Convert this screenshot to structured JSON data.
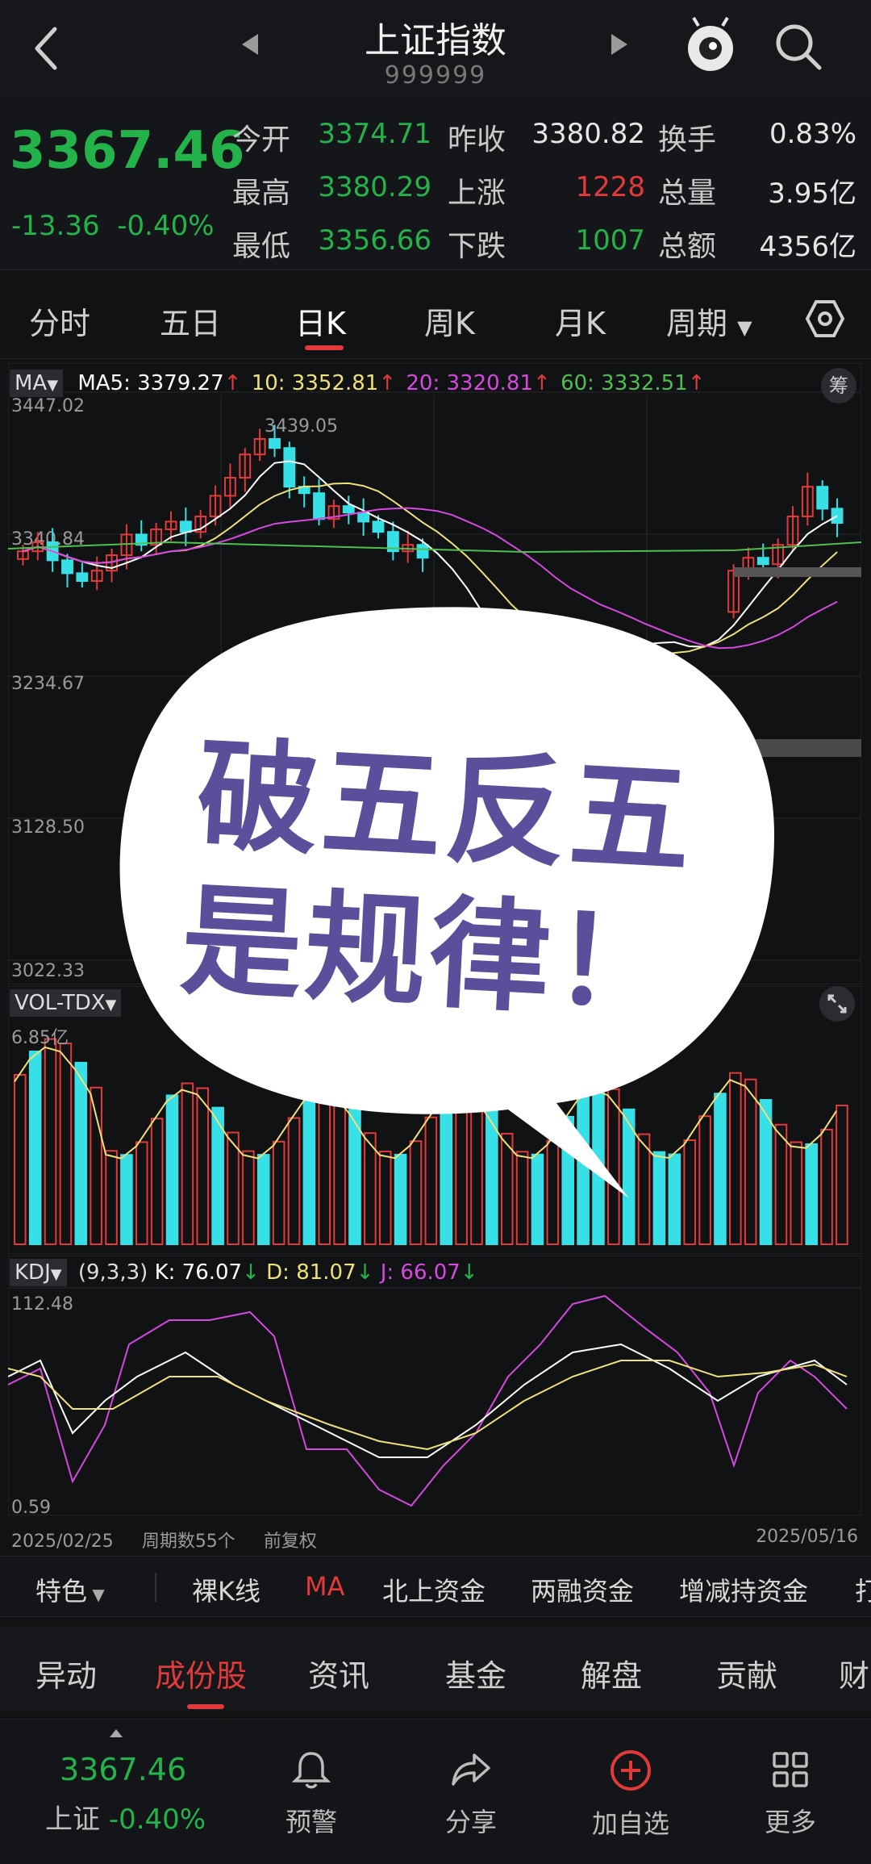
{
  "nav": {
    "title": "上证指数",
    "code": "999999"
  },
  "quote": {
    "price": "3367.46",
    "change": "-13.36",
    "change_pct": "-0.40%",
    "rows": [
      [
        {
          "label": "今开",
          "value": "3374.71",
          "color": "#23b34a"
        },
        {
          "label": "昨收",
          "value": "3380.82",
          "color": "#e6e6e6"
        },
        {
          "label": "换手",
          "value": "0.83%",
          "color": "#e6e6e6"
        }
      ],
      [
        {
          "label": "最高",
          "value": "3380.29",
          "color": "#23b34a"
        },
        {
          "label": "上涨",
          "value": "1228",
          "color": "#e23a3a"
        },
        {
          "label": "总量",
          "value": "3.95亿",
          "color": "#e6e6e6"
        }
      ],
      [
        {
          "label": "最低",
          "value": "3356.66",
          "color": "#23b34a"
        },
        {
          "label": "下跌",
          "value": "1007",
          "color": "#23b34a"
        },
        {
          "label": "总额",
          "value": "4356亿",
          "color": "#e6e6e6"
        }
      ]
    ]
  },
  "tabs": [
    "分时",
    "五日",
    "日K",
    "周K",
    "月K",
    "周期"
  ],
  "active_tab": "日K",
  "ma_legend": {
    "selector": "MA",
    "ma5": "MA5: 3379.27",
    "ma10": "10: 3352.81",
    "ma20": "20: 3320.81",
    "ma60": "60: 3332.51",
    "chip": "筹"
  },
  "kchart": {
    "y_labels": [
      "3447.02",
      "3340.84",
      "3234.67",
      "3128.50",
      "3022.33"
    ],
    "peak_label": "3439.05"
  },
  "vol": {
    "selector": "VOL-TDX",
    "max_label": "6.85亿"
  },
  "kdj": {
    "selector": "KDJ",
    "params": "(9,3,3)",
    "k": "K: 76.07",
    "d": "D: 81.07",
    "j": "J: 66.07",
    "y_top": "112.48",
    "y_bottom": "0.59",
    "date_start": "2025/02/25",
    "period_count": "周期数55个",
    "adjust": "前复权",
    "date_end": "2025/05/16"
  },
  "bubble": {
    "line1": "破五反五",
    "line2": "是规律！"
  },
  "features": [
    "特色",
    "裸K线",
    "MA",
    "北上资金",
    "两融资金",
    "增减持资金",
    "打"
  ],
  "subtabs": [
    "异动",
    "成份股",
    "资讯",
    "基金",
    "解盘",
    "贡献",
    "财"
  ],
  "active_subtab": "成份股",
  "bottom": {
    "price": "3367.46",
    "name": "上证",
    "pct": "-0.40%",
    "items": [
      "预警",
      "分享",
      "加自选",
      "更多"
    ]
  },
  "colors": {
    "up": "#e23a3a",
    "down": "#23b34a",
    "cyan": "#37e0e6",
    "ma10": "#f0e07a",
    "ma20": "#d648e0",
    "ma60": "#4fbf4f"
  }
}
